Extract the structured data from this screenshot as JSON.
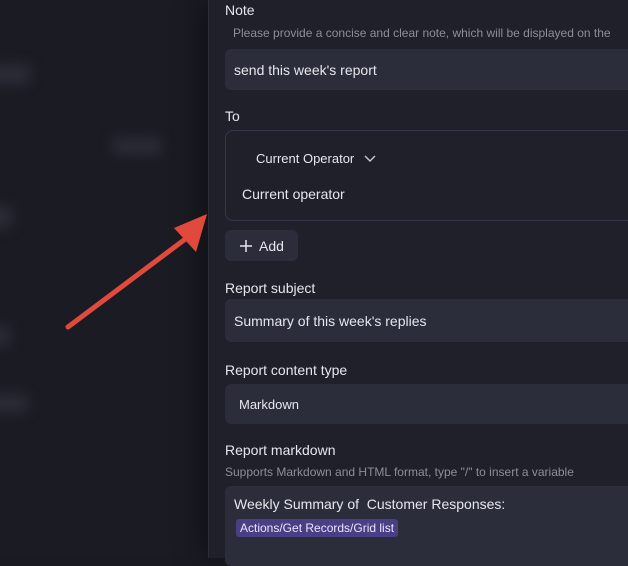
{
  "note": {
    "label": "Note",
    "hint": "Please provide a concise and clear note, which will be displayed on the",
    "value": "send this week's report"
  },
  "to": {
    "label": "To",
    "selector": "Current Operator",
    "value": "Current operator",
    "add_label": "Add"
  },
  "report_subject": {
    "label": "Report subject",
    "value": "Summary of this week's replies"
  },
  "report_content_type": {
    "label": "Report content type",
    "value": "Markdown"
  },
  "report_markdown": {
    "label": "Report markdown",
    "hint": "Supports Markdown and HTML format, type \"/\" to insert a variable",
    "text": "Weekly Summary of  Customer Responses:",
    "variable": "Actions/Get Records/Grid list"
  },
  "colors": {
    "annotation_arrow": "#e0493c",
    "variable_chip": "#4a3f84"
  }
}
